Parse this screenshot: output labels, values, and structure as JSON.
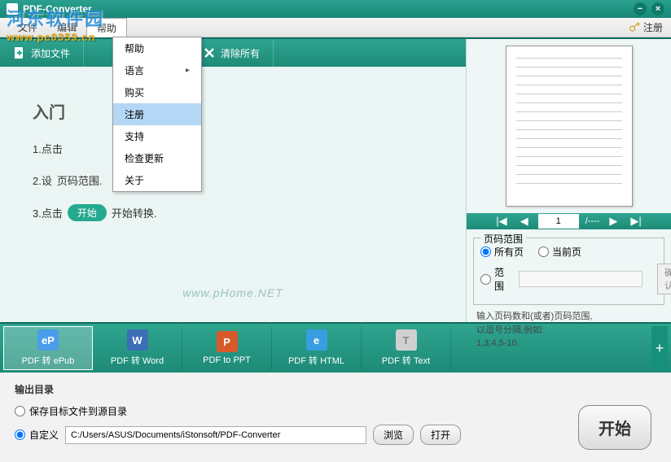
{
  "window": {
    "title": "PDF-Converter"
  },
  "menubar": {
    "file": "文件",
    "edit": "编辑",
    "help_top": "帮助",
    "register": "注册"
  },
  "dropdown": {
    "help": "帮助",
    "language": "语言",
    "buy": "购买",
    "register": "注册",
    "support": "支持",
    "check_update": "检查更新",
    "about": "关于"
  },
  "toolbar": {
    "add_file": "添加文件",
    "clear_all": "清除所有"
  },
  "main": {
    "heading": "入门",
    "step1": "1.点击",
    "step2_prefix": "2.设",
    "step2_suffix": "页码范围.",
    "step3_prefix": "3.点击",
    "step3_btn": "开始",
    "step3_suffix": "开始转换.",
    "watermark": "www.pHome.NET"
  },
  "preview_nav": {
    "page_input": "1",
    "page_total": "/----"
  },
  "range": {
    "legend": "页码范围",
    "all": "所有页",
    "current": "当前页",
    "range_label": "范围",
    "confirm": "确认",
    "hint1": "输入页码数和(或者)页码范围,",
    "hint2": "以逗号分隔,例如:",
    "hint3": "1,3,4,5-10."
  },
  "tabs": {
    "epub": "PDF 转 ePub",
    "word": "PDF 转 Word",
    "ppt": "PDF to PPT",
    "html": "PDF 转 HTML",
    "text": "PDF 转 Text"
  },
  "output": {
    "title": "输出目录",
    "save_source": "保存目标文件到源目录",
    "custom": "自定义",
    "path": "C:/Users/ASUS/Documents/iStonsoft/PDF-Converter",
    "browse": "浏览",
    "open": "打开",
    "start": "开始"
  },
  "overlay": {
    "name": "河东软件园",
    "url": "www.pc0359.cn"
  }
}
